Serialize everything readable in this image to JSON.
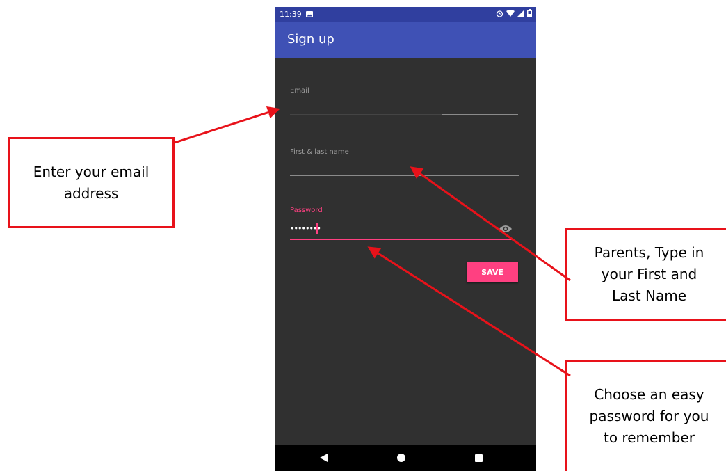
{
  "status_bar": {
    "time": "11:39",
    "icons": [
      "image-icon",
      "alarm-icon",
      "wifi-icon",
      "signal-icon",
      "battery-icon"
    ]
  },
  "app_bar": {
    "title": "Sign up"
  },
  "form": {
    "email": {
      "label": "Email",
      "value": ""
    },
    "name": {
      "label": "First & last name",
      "value": ""
    },
    "password": {
      "label": "Password",
      "value": "••••••••"
    },
    "save_label": "SAVE"
  },
  "nav_bar": {
    "icons": [
      "back-icon",
      "home-icon",
      "recents-icon"
    ]
  },
  "callouts": {
    "email": {
      "line1": "Enter your email",
      "line2": "address"
    },
    "name": {
      "line1": "Parents, Type in",
      "line2": "your First and",
      "line3": "Last Name"
    },
    "password": {
      "line1": "Choose an easy",
      "line2": "password for you",
      "line3": "to remember"
    }
  },
  "colors": {
    "primary": "#3F51B5",
    "primary_dark": "#303F9F",
    "accent": "#FF4081",
    "background": "#303030",
    "callout_border": "#e8121a"
  }
}
